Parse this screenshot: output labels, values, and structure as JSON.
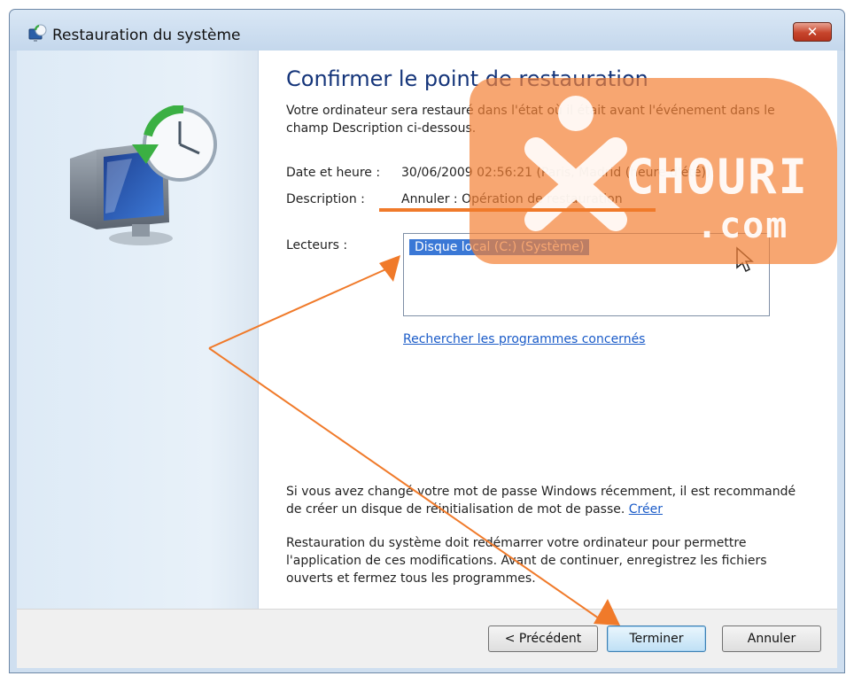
{
  "window": {
    "title": "Restauration du système",
    "close_label": "✕"
  },
  "content": {
    "heading": "Confirmer le point de restauration",
    "description": "Votre ordinateur sera restauré dans l'état où il était avant l'événement dans le champ Description ci-dessous.",
    "date_label": "Date et heure :",
    "date_value": "30/06/2009 02:56:21 (Paris, Madrid (heure d'été))",
    "description_label": "Description :",
    "description_value": "Annuler : Opération de restauration",
    "drives_label": "Lecteurs :",
    "drives": [
      "Disque local (C:) (Système)"
    ],
    "affected_programs_link": "Rechercher les programmes concernés",
    "password_note": "Si vous avez changé votre mot de passe Windows récemment, il est recommandé de créer un disque de réinitialisation de mot de passe.",
    "password_link": "Créer",
    "restart_note": "Restauration du système doit redémarrer votre ordinateur pour permettre l'application de ces modifications. Avant de continuer, enregistrez les fichiers ouverts et fermez tous les programmes."
  },
  "buttons": {
    "previous": "< Précédent",
    "finish": "Terminer",
    "cancel": "Annuler"
  },
  "watermark": {
    "line1": "CHOURI",
    "line2": ".com"
  },
  "colors": {
    "heading": "#15357a",
    "link": "#1a5bc8",
    "selection": "#3a78d6",
    "annotation": "#f07a2a",
    "close_button": "#c7452c"
  }
}
